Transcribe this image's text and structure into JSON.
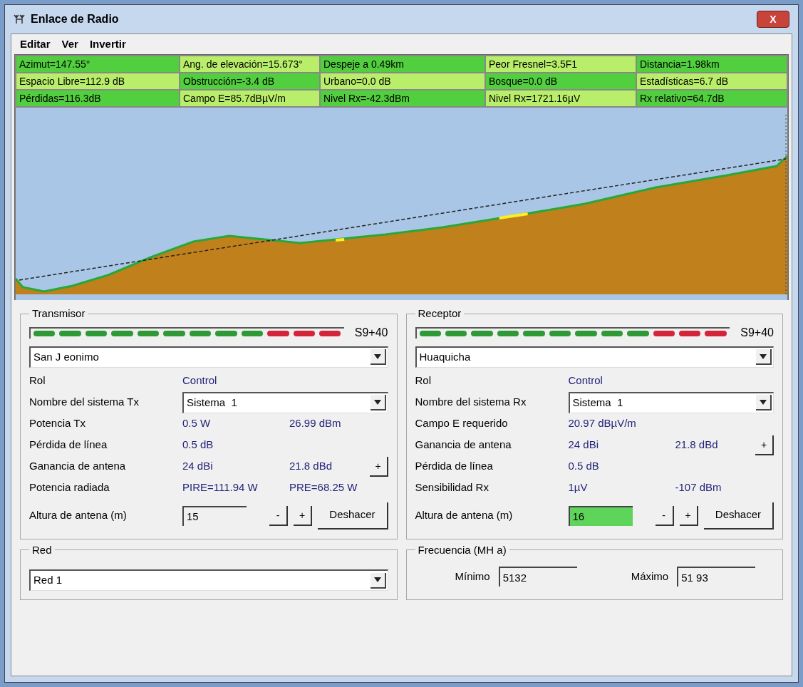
{
  "window": {
    "title": "Enlace de Radio",
    "close": "X"
  },
  "menu": [
    "Editar",
    "Ver",
    "Invertir"
  ],
  "info": [
    [
      "Azimut=147.55°",
      "Ang. de elevación=15.673°",
      "Despeje a 0.49km",
      "Peor Fresnel=3.5F1",
      "Distancia=1.98km"
    ],
    [
      "Espacio Libre=112.9 dB",
      "Obstrucción=-3.4 dB",
      "Urbano=0.0 dB",
      "Bosque=0.0 dB",
      "Estadísticas=6.7 dB"
    ],
    [
      "Pérdidas=116.3dB",
      "Campo E=85.7dBµV/m",
      "Nivel Rx=-42.3dBm",
      "Nivel Rx=1721.16µV",
      "Rx relativo=64.7dB"
    ]
  ],
  "transmitter": {
    "title": "Transmisor",
    "meter": {
      "level": 1,
      "reading": "S9+40"
    },
    "station": "San J eonimo",
    "rows": [
      {
        "kind": "text",
        "label": "Rol",
        "value": "Control"
      },
      {
        "kind": "select",
        "label": "Nombre del sistema Tx",
        "value": "Sistema  1"
      },
      {
        "kind": "text",
        "label": "Potencia Tx",
        "value": "0.5 W",
        "value_2": "26.99 dBm"
      },
      {
        "kind": "text",
        "label": "Pérdida de línea",
        "value": "0.5 dB"
      },
      {
        "kind": "text",
        "label": "Ganancia de antena",
        "value": "24 dBi",
        "value_2": "21.8 dBd",
        "button": "+"
      },
      {
        "kind": "text",
        "label": "Potencia radiada",
        "value": "PIRE=111.94 W",
        "value_2": "PRE=68.25 W"
      }
    ],
    "height": {
      "label": "Altura de antena (m)",
      "value": "15",
      "highlighted": false,
      "minus": "-",
      "plus": "+",
      "undo": "Deshacer"
    }
  },
  "receiver": {
    "title": "Receptor",
    "meter": {
      "level": 1,
      "reading": "S9+40"
    },
    "station": "Huaquicha",
    "rows": [
      {
        "kind": "text",
        "label": "Rol",
        "value": "Control"
      },
      {
        "kind": "select",
        "label": "Nombre del sistema Rx",
        "value": "Sistema  1"
      },
      {
        "kind": "text",
        "label": "Campo E requerido",
        "value": "20.97 dBµV/m"
      },
      {
        "kind": "text",
        "label": "Ganancia de antena",
        "value": "24 dBi",
        "value_2": "21.8 dBd",
        "button": "+"
      },
      {
        "kind": "text",
        "label": "Pérdida de línea",
        "value": "0.5 dB"
      },
      {
        "kind": "text",
        "label": "Sensibilidad Rx",
        "value": "1µV",
        "value_2": "-107 dBm"
      }
    ],
    "height": {
      "label": "Altura de antena (m)",
      "value": "16",
      "highlighted": true,
      "minus": "-",
      "plus": "+",
      "undo": "Deshacer"
    }
  },
  "network": {
    "title": "Red",
    "value": "Red 1"
  },
  "frequency": {
    "title": "Frecuencia (MH a)",
    "min_label": "Mínimo",
    "min": "5132",
    "max_label": "Máximo",
    "max": "51 93"
  }
}
